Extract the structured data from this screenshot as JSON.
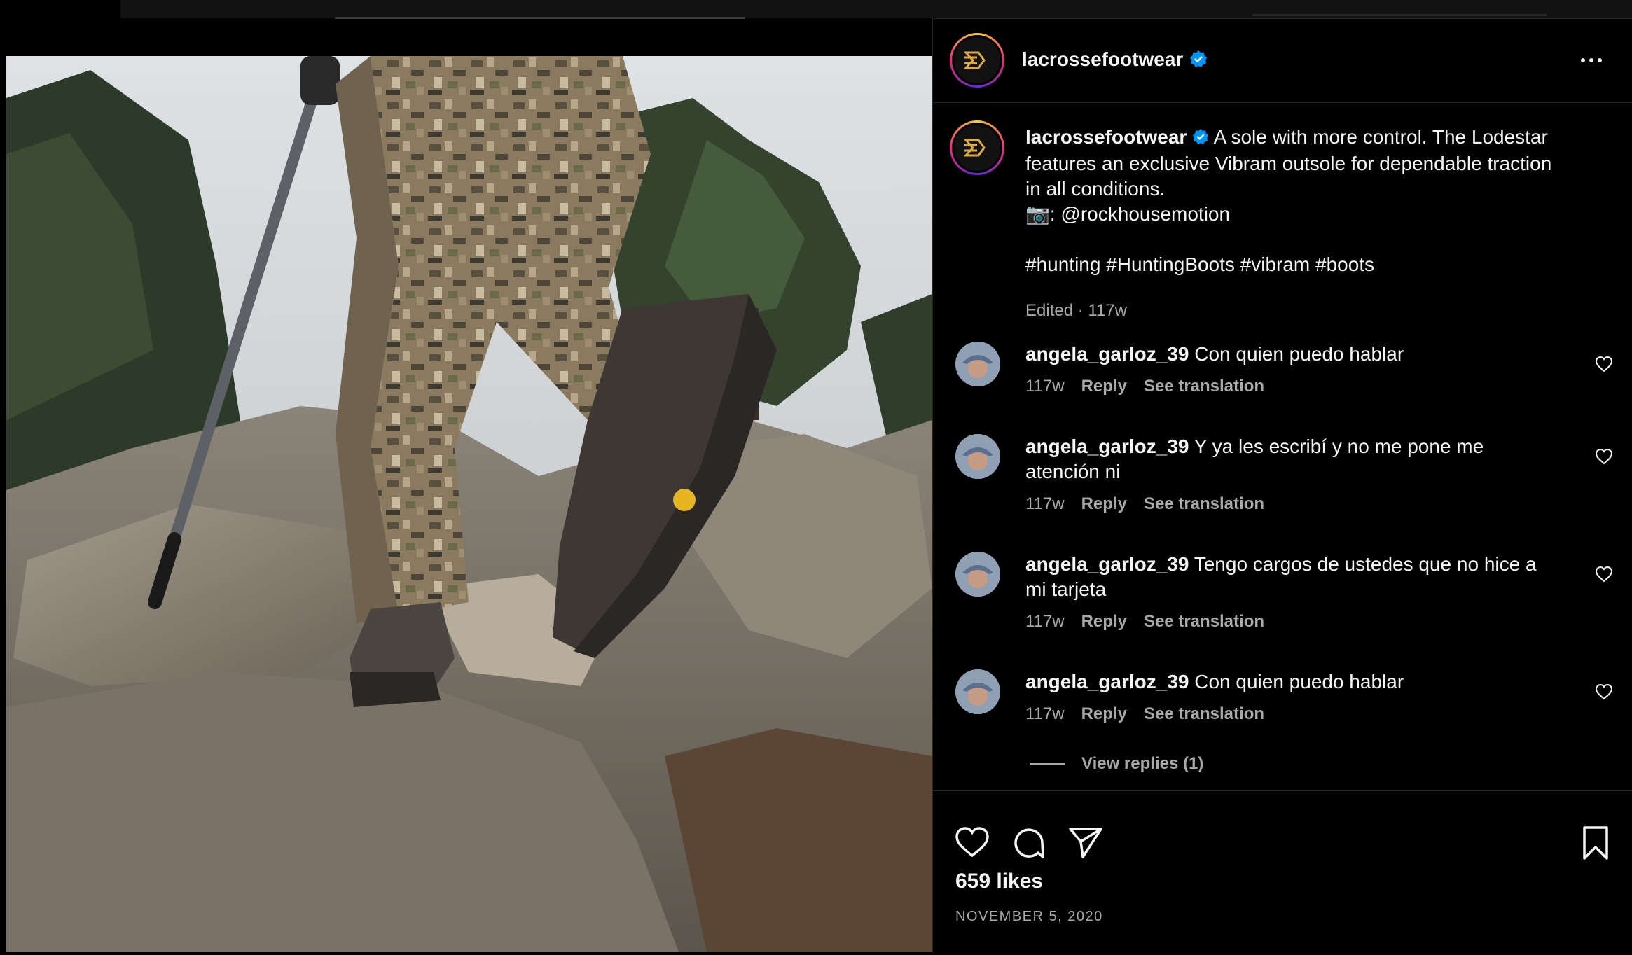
{
  "post": {
    "username": "lacrossefootwear",
    "caption_lines": [
      "A sole with more control. The Lodestar",
      "features an exclusive Vibram outsole for dependable traction",
      "in all conditions.",
      "📷: @rockhousemotion",
      "",
      "#hunting #HuntingBoots #vibram #boots"
    ],
    "meta": "Edited · 117w",
    "likes": "659 likes",
    "date": "NOVEMBER 5, 2020"
  },
  "comments": [
    {
      "user": "angela_garloz_39",
      "text": "Con quien puedo hablar",
      "time": "117w",
      "reply": "Reply",
      "translate": "See translation"
    },
    {
      "user": "angela_garloz_39",
      "text": "Y ya les escribí y no me pone me",
      "text2": "atención ni",
      "time": "117w",
      "reply": "Reply",
      "translate": "See translation"
    },
    {
      "user": "angela_garloz_39",
      "text": "Tengo cargos de ustedes que no hice a",
      "text2": "mi tarjeta",
      "time": "117w",
      "reply": "Reply",
      "translate": "See translation"
    },
    {
      "user": "angela_garloz_39",
      "text": "Con quien puedo hablar",
      "time": "117w",
      "reply": "Reply",
      "translate": "See translation"
    }
  ],
  "view_replies": "View replies (1)",
  "icons": {
    "verified": "verified-badge-icon",
    "more": "more-options-icon",
    "like": "heart-icon",
    "comment": "comment-icon",
    "share": "send-icon",
    "save": "bookmark-icon"
  },
  "colors": {
    "background": "#000000",
    "text": "#f5f5f5",
    "secondary_text": "#a8a8a8",
    "verified": "#0095f6",
    "logo_gold": "#e0a93b"
  }
}
